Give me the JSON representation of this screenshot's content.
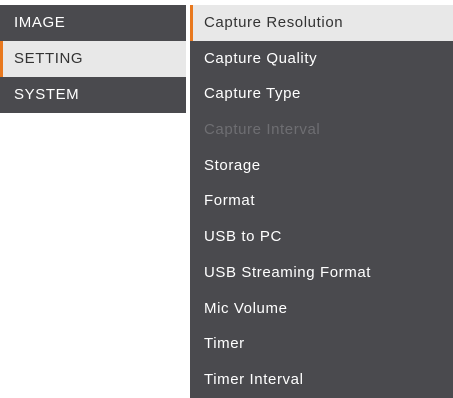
{
  "main_menu": {
    "items": [
      {
        "label": "IMAGE"
      },
      {
        "label": "SETTING"
      },
      {
        "label": "SYSTEM"
      }
    ],
    "selected_index": 1
  },
  "sub_menu": {
    "items": [
      {
        "label": "Capture Resolution"
      },
      {
        "label": "Capture Quality"
      },
      {
        "label": "Capture Type"
      },
      {
        "label": "Capture Interval"
      },
      {
        "label": "Storage"
      },
      {
        "label": "Format"
      },
      {
        "label": "USB to PC"
      },
      {
        "label": "USB Streaming Format"
      },
      {
        "label": "Mic Volume"
      },
      {
        "label": "Timer"
      },
      {
        "label": "Timer Interval"
      }
    ],
    "selected_index": 0,
    "disabled_indices": [
      3
    ]
  },
  "colors": {
    "menu_bg": "#4a4a4e",
    "selected_bg": "#e8e8e8",
    "accent": "#e8781e",
    "text": "#ffffff",
    "selected_text": "#333333",
    "disabled_text": "#6e6e72"
  }
}
